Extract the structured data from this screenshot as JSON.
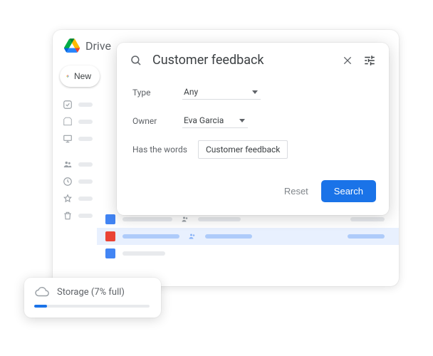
{
  "header": {
    "title": "Drive"
  },
  "sidebar": {
    "new_label": "New"
  },
  "search": {
    "query": "Customer feedback",
    "filters": {
      "type_label": "Type",
      "type_value": "Any",
      "owner_label": "Owner",
      "owner_value": "Eva Garcia",
      "words_label": "Has the words",
      "words_value": "Customer feedback"
    },
    "reset_label": "Reset",
    "search_label": "Search"
  },
  "storage": {
    "label": "Storage (7% full)",
    "percent": 7
  },
  "colors": {
    "accent": "#1a73e8"
  }
}
